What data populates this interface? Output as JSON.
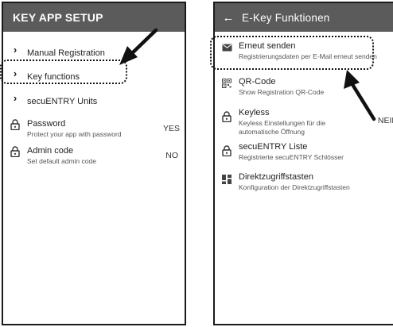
{
  "left_screen": {
    "title": "KEY APP SETUP",
    "nav_items": [
      {
        "label": "Manual Registration"
      },
      {
        "label": "Key functions"
      },
      {
        "label": "secuENTRY Units"
      }
    ],
    "settings": [
      {
        "label": "Password",
        "sublabel": "Protect your app with password",
        "value": "YES",
        "icon": "lock-icon"
      },
      {
        "label": "Admin code",
        "sublabel": "Set default admin code",
        "value": "NO",
        "icon": "lock-icon"
      }
    ]
  },
  "right_screen": {
    "title": "E-Key Funktionen",
    "items": [
      {
        "label": "Erneut senden",
        "sublabel": "Registrierungsdaten per E-Mail erneut senden",
        "icon": "email-icon"
      },
      {
        "label": "QR-Code",
        "sublabel": "Show Registration QR-Code",
        "icon": "qr-code-icon"
      },
      {
        "label": "Keyless",
        "sublabel": "Keyless Einstellungen für die automatische Öffnung",
        "value": "NEIN",
        "icon": "lock-icon"
      },
      {
        "label": "secuENTRY Liste",
        "sublabel": "Registrierte secuENTRY Schlösser",
        "icon": "lock-icon"
      },
      {
        "label": "Direktzugriffstasten",
        "sublabel": "Konfiguration der Direktzugriffstasten",
        "icon": "dashboard-icon"
      }
    ]
  },
  "colors": {
    "appbar": "#5b5b5b",
    "background": "#ffffff",
    "annotation": "#111111"
  }
}
